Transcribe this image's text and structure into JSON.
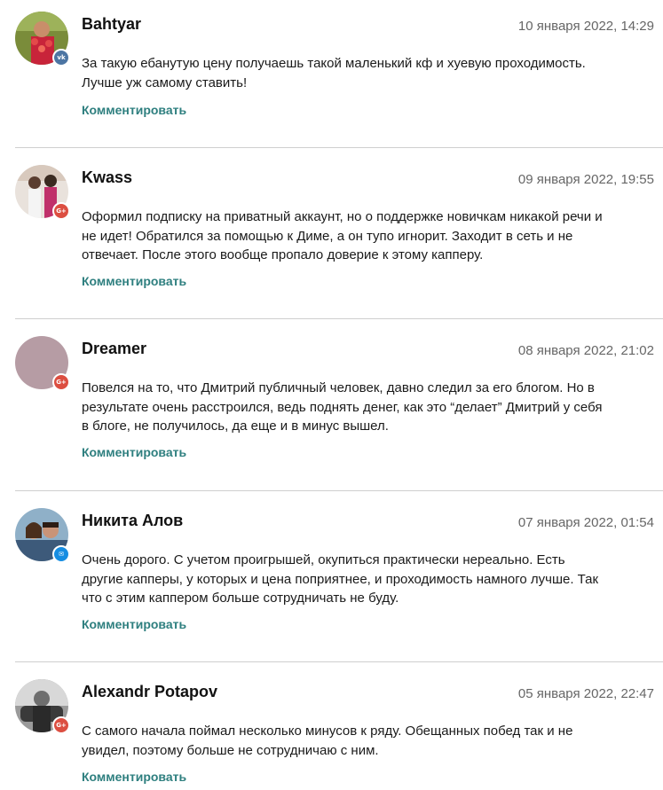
{
  "comments": [
    {
      "author": "Bahtyar",
      "date": "10 января 2022, 14:29",
      "text": "За такую ебанутую цену получаешь такой маленький кф и хуевую проходимость. Лучше уж самому ставить!",
      "reply_label": "Комментировать",
      "social": "vk",
      "social_icon": "vk-icon"
    },
    {
      "author": "Kwass",
      "date": "09 января 2022, 19:55",
      "text": "Оформил подписку на приватный аккаунт, но о поддержке новичкам никакой речи и не идет! Обратился за помощью к Диме, а он тупо игнорит. Заходит в сеть и не отвечает. После этого вообще пропало доверие к этому капперу.",
      "reply_label": "Комментировать",
      "social": "google-plus",
      "social_icon": "google-plus-icon"
    },
    {
      "author": "Dreamer",
      "date": "08 января 2022, 21:02",
      "text": "Повелся на то, что Дмитрий публичный человек, давно следил за его блогом. Но в результате очень расстроился, ведь поднять денег, как это “делает” Дмитрий у себя в блоге, не получилось, да еще и в минус вышел.",
      "reply_label": "Комментировать",
      "social": "google-plus",
      "social_icon": "google-plus-icon"
    },
    {
      "author": "Никита Алов",
      "date": "07 января 2022, 01:54",
      "text": "Очень дорого. С учетом проигрышей, окупиться практически нереально. Есть другие капперы, у которых и цена поприятнее, и проходимость намного лучше. Так что с этим каппером больше сотрудничать не буду.",
      "reply_label": "Комментировать",
      "social": "mail",
      "social_icon": "mail-icon"
    },
    {
      "author": "Alexandr Potapov",
      "date": "05 января 2022, 22:47",
      "text": "С самого начала поймал несколько минусов к ряду. Обещанных побед так и не увидел, поэтому больше не сотрудничаю с ним.",
      "reply_label": "Комментировать",
      "social": "google-plus",
      "social_icon": "google-plus-icon"
    }
  ],
  "colors": {
    "reply_link": "#2e7f7f",
    "date": "#666666",
    "divider": "#cfcfcf",
    "vk_badge": "#4c75a3",
    "google_plus_badge": "#dc4e41",
    "mail_badge": "#168de2"
  }
}
